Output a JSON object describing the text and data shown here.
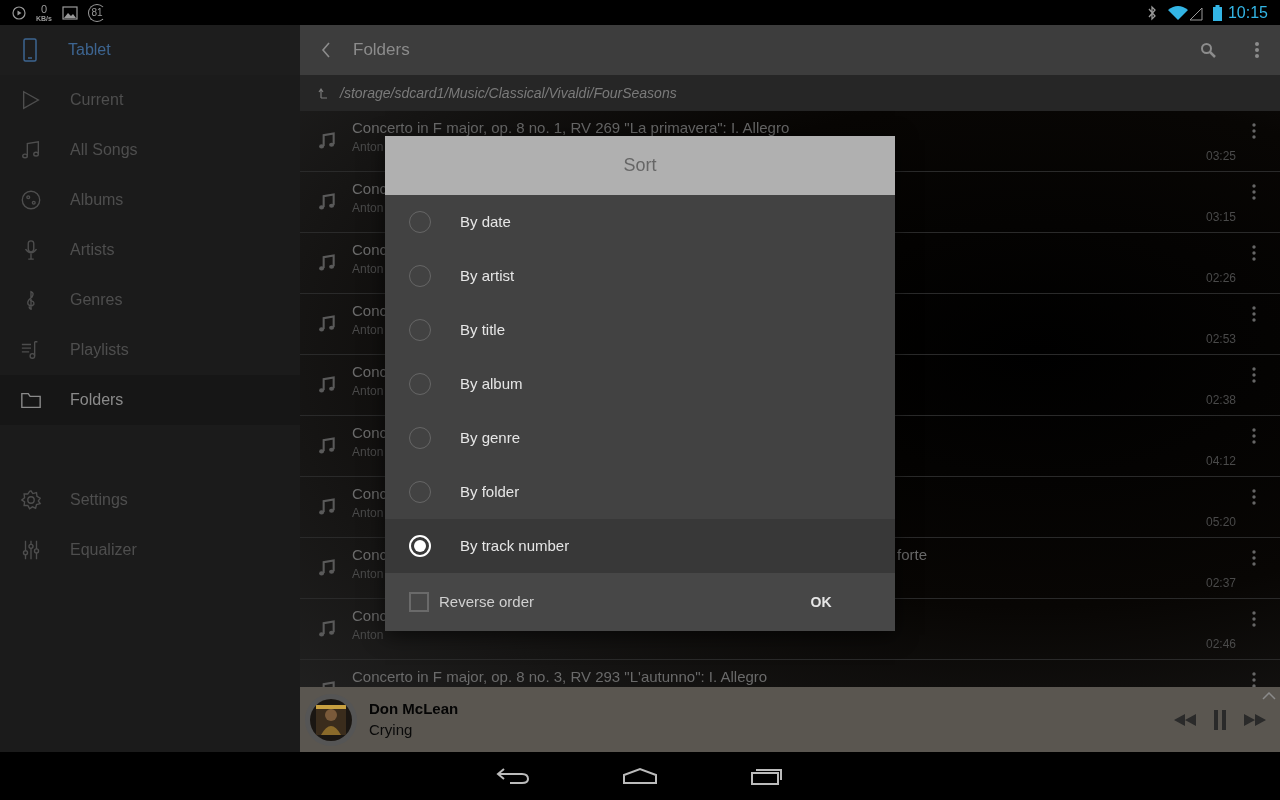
{
  "status_bar": {
    "speed_value": "0",
    "speed_unit": "KB/s",
    "badge": "81",
    "time": "10:15"
  },
  "sidebar": {
    "device": "Tablet",
    "items": [
      {
        "label": "Current",
        "selected": false
      },
      {
        "label": "All Songs",
        "selected": false
      },
      {
        "label": "Albums",
        "selected": false
      },
      {
        "label": "Artists",
        "selected": false
      },
      {
        "label": "Genres",
        "selected": false
      },
      {
        "label": "Playlists",
        "selected": false
      },
      {
        "label": "Folders",
        "selected": true
      }
    ],
    "footer_items": [
      {
        "label": "Settings"
      },
      {
        "label": "Equalizer"
      }
    ]
  },
  "toolbar": {
    "title": "Folders"
  },
  "path": "/storage/sdcard1/Music/Classical/Vivaldi/FourSeasons",
  "rows": [
    {
      "title": "Concerto in F major, op. 8 no. 1, RV 269 \"La primavera\": I. Allegro",
      "artist": "Anton",
      "duration": "03:25"
    },
    {
      "title": "Conc",
      "artist": "Anton",
      "duration": "03:15"
    },
    {
      "title": "Conc",
      "artist": "Anton",
      "duration": "02:26"
    },
    {
      "title": "Conc",
      "artist": "Anton",
      "duration": "02:53"
    },
    {
      "title": "Conc",
      "artist": "Anton",
      "duration": "02:38"
    },
    {
      "title": "Conc",
      "artist": "Anton",
      "duration": "04:12"
    },
    {
      "title": "Conc",
      "artist": "Anton",
      "duration": "05:20"
    },
    {
      "title": "Conc",
      "title_tail": "forte",
      "artist": "Anton",
      "duration": "02:37"
    },
    {
      "title": "Conc",
      "artist": "Anton",
      "duration": "02:46"
    },
    {
      "title": "Concerto in F major, op. 8 no. 3, RV 293 \"L'autunno\": I. Allegro"
    }
  ],
  "dialog": {
    "title": "Sort",
    "options": [
      {
        "label": "By date",
        "selected": false
      },
      {
        "label": "By artist",
        "selected": false
      },
      {
        "label": "By title",
        "selected": false
      },
      {
        "label": "By album",
        "selected": false
      },
      {
        "label": "By genre",
        "selected": false
      },
      {
        "label": "By folder",
        "selected": false
      },
      {
        "label": "By track number",
        "selected": true
      }
    ],
    "reverse_order": {
      "label": "Reverse order",
      "checked": false
    },
    "ok": "OK"
  },
  "player": {
    "artist": "Don McLean",
    "track": "Crying"
  }
}
